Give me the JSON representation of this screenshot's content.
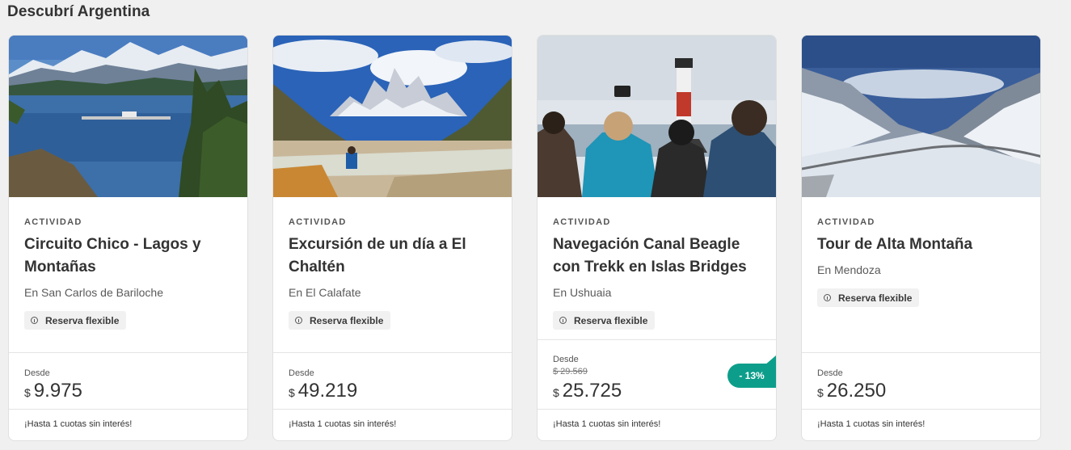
{
  "section": {
    "title": "Descubrí Argentina"
  },
  "cards": [
    {
      "kind": "ACTIVIDAD",
      "title": "Circuito Chico - Lagos y Montañas",
      "location": "En San Carlos de Bariloche",
      "badge": "Reserva flexible",
      "from_label": "Desde",
      "currency": "$",
      "price": "9.975",
      "installments": "¡Hasta 1 cuotas sin interés!"
    },
    {
      "kind": "ACTIVIDAD",
      "title": "Excursión de un día a El Chaltén",
      "location": "En El Calafate",
      "badge": "Reserva flexible",
      "from_label": "Desde",
      "currency": "$",
      "price": "49.219",
      "installments": "¡Hasta 1 cuotas sin interés!"
    },
    {
      "kind": "ACTIVIDAD",
      "title": "Navegación Canal Beagle con Trekk en Islas Bridges",
      "location": "En Ushuaia",
      "badge": "Reserva flexible",
      "from_label": "Desde",
      "old_price": "$ 29.569",
      "currency": "$",
      "price": "25.725",
      "discount": "- 13%",
      "installments": "¡Hasta 1 cuotas sin interés!"
    },
    {
      "kind": "ACTIVIDAD",
      "title": "Tour de Alta Montaña",
      "location": "En Mendoza",
      "badge": "Reserva flexible",
      "from_label": "Desde",
      "currency": "$",
      "price": "26.250",
      "installments": "¡Hasta 1 cuotas sin interés!"
    }
  ],
  "colors": {
    "discount": "#0d9e8b",
    "background": "#f0f0f0"
  },
  "icons": {
    "badge": "info-circle-icon"
  }
}
